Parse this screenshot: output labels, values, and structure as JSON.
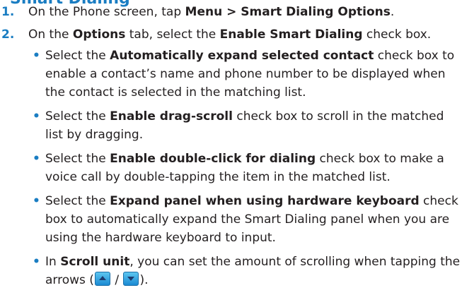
{
  "heading_partial": "Smart Dialing",
  "steps": [
    {
      "num": "1.",
      "p1": "On the Phone screen, tap ",
      "b1": "Menu > Smart Dialing Options",
      "p2": "."
    },
    {
      "num": "2.",
      "p1": "On the ",
      "b1": "Options",
      "p2": " tab, select the ",
      "b2": "Enable Smart Dialing",
      "p3": " check box."
    }
  ],
  "bullets": [
    {
      "pre": "Select the ",
      "bold": "Automatically expand selected contact",
      "post": " check box to enable a contact’s name and phone number to be displayed when the contact is selected in the matching list."
    },
    {
      "pre": "Select the ",
      "bold": "Enable drag-scroll",
      "post": " check box to scroll in the matched list by dragging."
    },
    {
      "pre": "Select the ",
      "bold": "Enable double-click for dialing",
      "post": " check box to make a voice call by double-tapping the item in the matched list."
    },
    {
      "pre": "Select the ",
      "bold": "Expand panel when using hardware keyboard",
      "post": " check box to automatically expand the Smart Dialing panel when you are using the hardware keyboard to input."
    },
    {
      "pre": "In ",
      "bold": "Scroll unit",
      "post": ", you can set the amount of scrolling when tapping the arrows (",
      "sep": " / ",
      "end": ")."
    }
  ],
  "bullet_char": "•",
  "icons": {
    "up": "scroll-up-arrow-icon",
    "down": "scroll-down-arrow-icon"
  },
  "colors": {
    "accent": "#1a7dc2",
    "text": "#231f20"
  }
}
